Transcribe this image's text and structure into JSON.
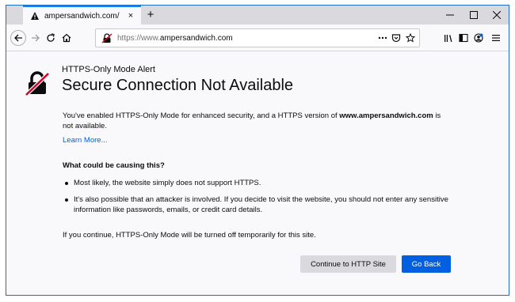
{
  "browser": {
    "tab": {
      "title": "ampersandwich.com/",
      "close": "×"
    },
    "new_tab": "+",
    "url": {
      "scheme": "https://www.",
      "host": "ampersandwich.com"
    }
  },
  "page": {
    "subtitle": "HTTPS-Only Mode Alert",
    "title": "Secure Connection Not Available",
    "intro_before": "You've enabled HTTPS-Only Mode for enhanced security, and a HTTPS version of ",
    "intro_domain": "www.ampersandwich.com",
    "intro_after": " is not available.",
    "learn_more": "Learn More...",
    "causes_heading": "What could be causing this?",
    "causes": [
      "Most likely, the website simply does not support HTTPS.",
      "It's also possible that an attacker is involved. If you decide to visit the website, you should not enter any sensitive information like passwords, emails, or credit card details."
    ],
    "continue_note": "If you continue, HTTPS-Only Mode will be turned off temporarily for this site.",
    "continue_button": "Continue to HTTP Site",
    "go_back_button": "Go Back"
  },
  "colors": {
    "accent": "#0060df",
    "tab_highlight": "#0a84ff",
    "warning_slash": "#d70022"
  },
  "icons": [
    "warning-icon",
    "close-icon",
    "plus-icon",
    "minimize-icon",
    "maximize-icon",
    "back-arrow-icon",
    "forward-arrow-icon",
    "reload-icon",
    "home-icon",
    "insecure-lock-icon",
    "more-actions-icon",
    "pocket-icon",
    "bookmark-star-icon",
    "library-icon",
    "sidebar-icon",
    "account-icon",
    "menu-icon",
    "broken-lock-icon"
  ]
}
